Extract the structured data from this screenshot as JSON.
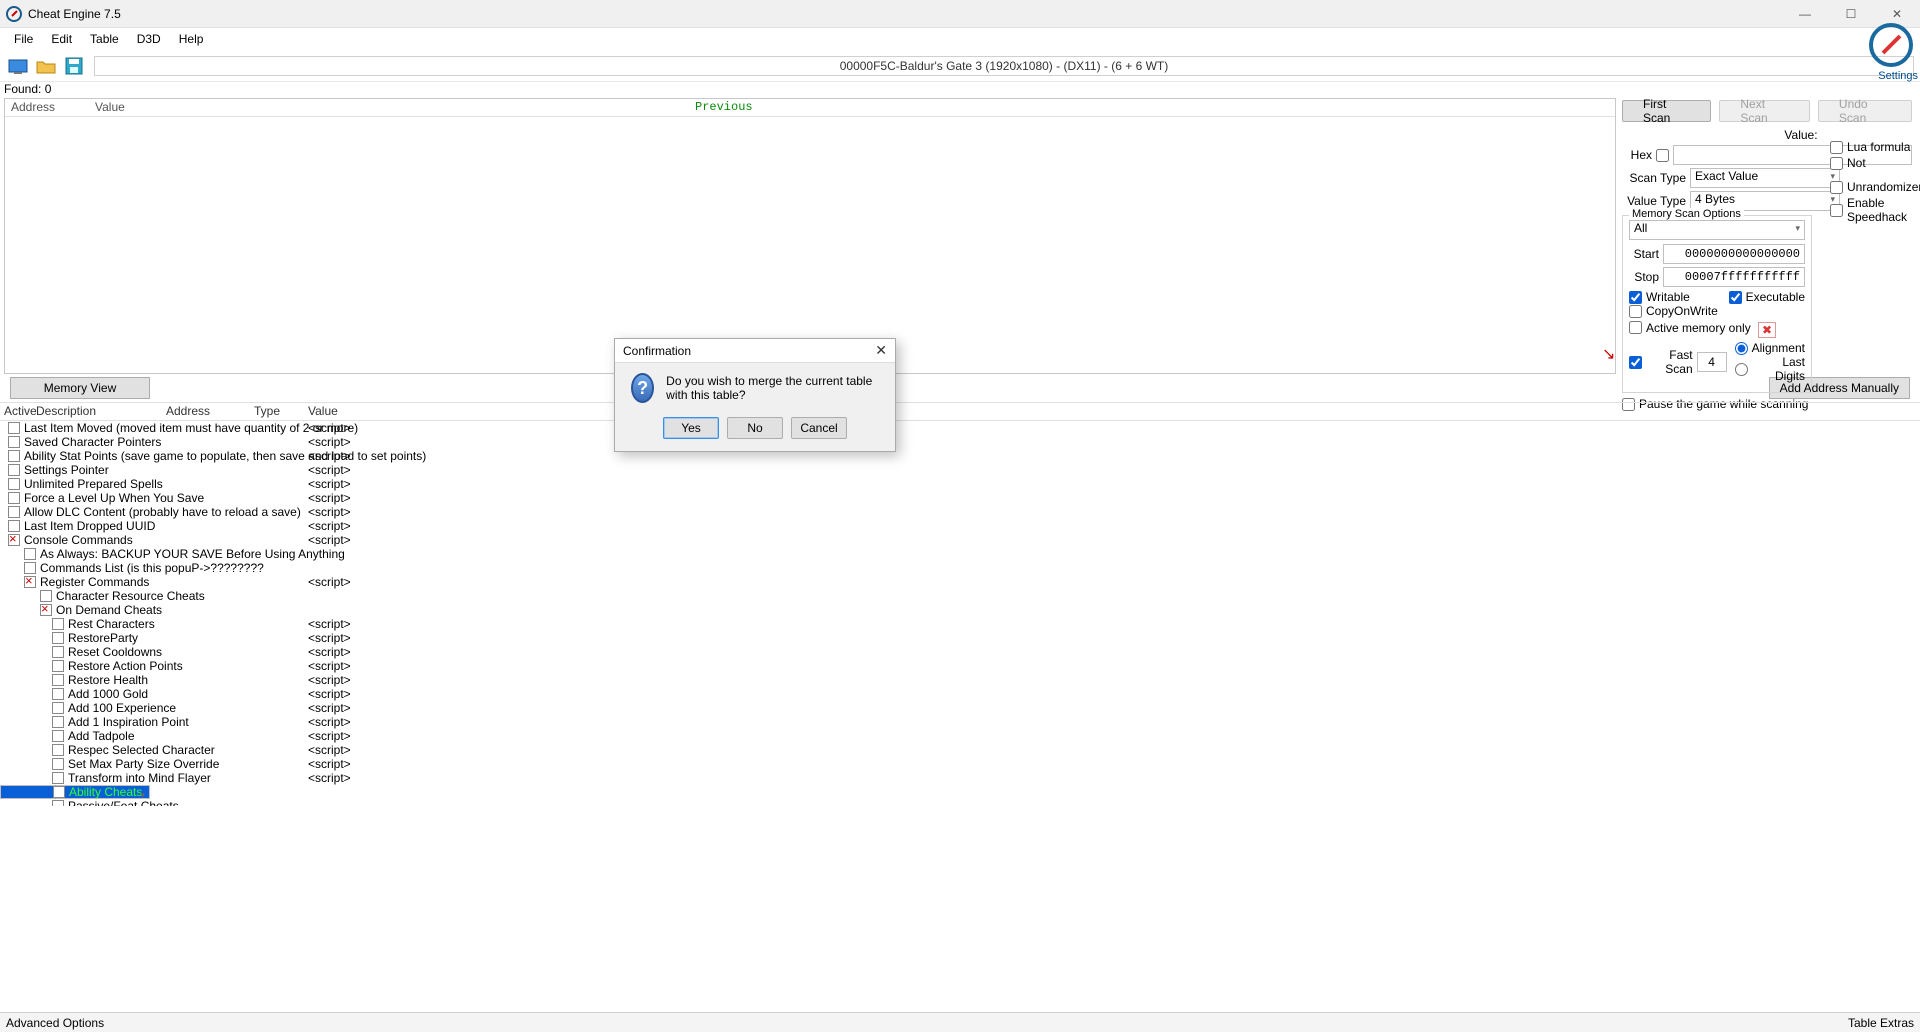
{
  "window": {
    "title": "Cheat Engine 7.5"
  },
  "menu": {
    "file": "File",
    "edit": "Edit",
    "table": "Table",
    "d3d": "D3D",
    "help": "Help"
  },
  "process_title": "00000F5C-Baldur's Gate 3 (1920x1080) - (DX11) - (6 + 6 WT)",
  "settings_label": "Settings",
  "found": "Found: 0",
  "results_headers": {
    "address": "Address",
    "value": "Value",
    "previous": "Previous"
  },
  "scan": {
    "first": "First Scan",
    "next": "Next Scan",
    "undo": "Undo Scan",
    "value_label": "Value:",
    "hex": "Hex",
    "scan_type_label": "Scan Type",
    "scan_type_value": "Exact Value",
    "value_type_label": "Value Type",
    "value_type_value": "4 Bytes",
    "lua": "Lua formula",
    "not": "Not",
    "mem_options": "Memory Scan Options",
    "region": "All",
    "start_label": "Start",
    "start_value": "0000000000000000",
    "stop_label": "Stop",
    "stop_value": "00007fffffffffff",
    "writable": "Writable",
    "executable": "Executable",
    "cow": "CopyOnWrite",
    "active_mem": "Active memory only",
    "fast": "Fast Scan",
    "fast_val": "4",
    "alignment": "Alignment",
    "last_digits": "Last Digits",
    "pause": "Pause the game while scanning",
    "unrandom": "Unrandomizer",
    "speedhack": "Enable Speedhack"
  },
  "buttons": {
    "memview": "Memory View",
    "addaddr": "Add Address Manually"
  },
  "table_headers": {
    "active": "Active",
    "description": "Description",
    "address": "Address",
    "type": "Type",
    "value": "Value"
  },
  "script_txt": "<script>",
  "cheat_rows": [
    {
      "indent": 0,
      "x": false,
      "desc": "Last Item Moved (moved item must have quantity of 2 or more)",
      "type": "<script>"
    },
    {
      "indent": 0,
      "x": false,
      "desc": "Saved Character Pointers",
      "type": "<script>"
    },
    {
      "indent": 0,
      "x": false,
      "desc": "Ability Stat Points (save game to populate, then save and load to set points)",
      "type": "<script>"
    },
    {
      "indent": 0,
      "x": false,
      "desc": "Settings Pointer",
      "type": "<script>"
    },
    {
      "indent": 0,
      "x": false,
      "desc": "Unlimited Prepared Spells",
      "type": "<script>"
    },
    {
      "indent": 0,
      "x": false,
      "desc": "Force a Level Up When You Save",
      "type": "<script>"
    },
    {
      "indent": 0,
      "x": false,
      "desc": "Allow DLC Content (probably have to reload a save)",
      "type": "<script>"
    },
    {
      "indent": 0,
      "x": false,
      "desc": "Last Item Dropped UUID",
      "type": "<script>"
    },
    {
      "indent": 0,
      "x": true,
      "desc": "Console Commands",
      "type": "<script>"
    },
    {
      "indent": 1,
      "x": false,
      "desc": "As Always: BACKUP YOUR SAVE Before Using Anything",
      "type": ""
    },
    {
      "indent": 1,
      "x": false,
      "desc": "Commands List (is this popuP->????????",
      "type": ""
    },
    {
      "indent": 1,
      "x": true,
      "desc": "Register Commands",
      "type": "<script>"
    },
    {
      "indent": 2,
      "x": false,
      "desc": "Character Resource Cheats",
      "type": ""
    },
    {
      "indent": 2,
      "x": true,
      "desc": "On Demand Cheats",
      "type": ""
    },
    {
      "indent": 3,
      "x": false,
      "desc": "Rest Characters",
      "type": "<script>"
    },
    {
      "indent": 3,
      "x": false,
      "desc": "RestoreParty",
      "type": "<script>"
    },
    {
      "indent": 3,
      "x": false,
      "desc": "Reset Cooldowns",
      "type": "<script>"
    },
    {
      "indent": 3,
      "x": false,
      "desc": "Restore Action Points",
      "type": "<script>"
    },
    {
      "indent": 3,
      "x": false,
      "desc": "Restore Health",
      "type": "<script>"
    },
    {
      "indent": 3,
      "x": false,
      "desc": "Add 1000 Gold",
      "type": "<script>"
    },
    {
      "indent": 3,
      "x": false,
      "desc": "Add 100 Experience",
      "type": "<script>"
    },
    {
      "indent": 3,
      "x": false,
      "desc": "Add 1 Inspiration Point",
      "type": "<script>"
    },
    {
      "indent": 3,
      "x": false,
      "desc": "Add Tadpole",
      "type": "<script>"
    },
    {
      "indent": 3,
      "x": false,
      "desc": "Respec Selected Character",
      "type": "<script>"
    },
    {
      "indent": 3,
      "x": false,
      "desc": "Set Max Party Size Override",
      "type": "<script>"
    },
    {
      "indent": 3,
      "x": false,
      "desc": "Transform into Mind Flayer",
      "type": "<script>"
    },
    {
      "indent": 3,
      "x": false,
      "desc": "Ability Cheats",
      "type": "",
      "selected": true
    },
    {
      "indent": 3,
      "x": false,
      "desc": "Passive/Feat Cheats",
      "type": ""
    }
  ],
  "status": {
    "left": "Advanced Options",
    "right": "Table Extras"
  },
  "dialog": {
    "title": "Confirmation",
    "message": "Do you wish to merge the current table with this table?",
    "yes": "Yes",
    "no": "No",
    "cancel": "Cancel"
  }
}
